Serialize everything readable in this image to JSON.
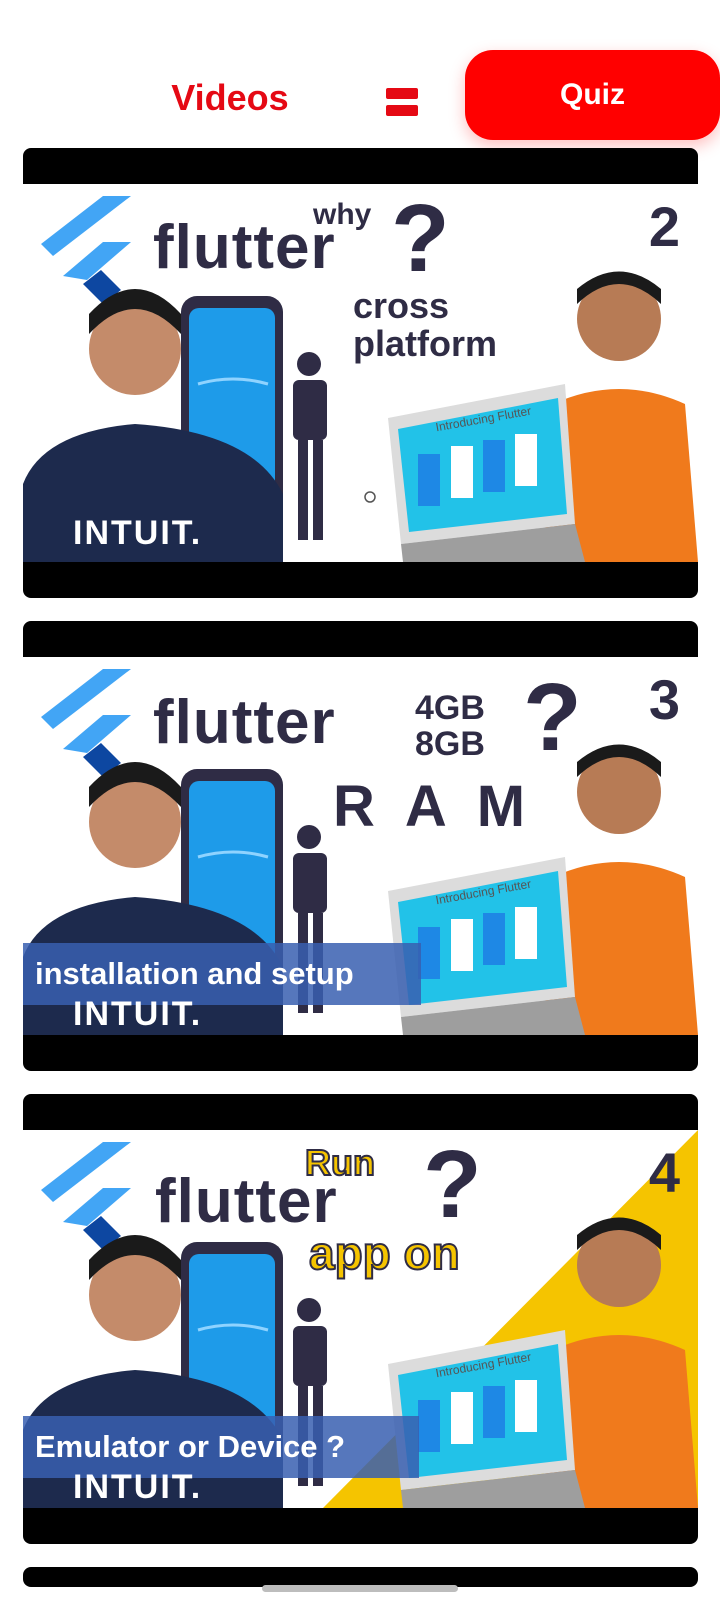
{
  "header": {
    "tab_videos": "Videos",
    "quiz_button": "Quiz",
    "accent_color": "#e50914"
  },
  "videos": [
    {
      "number": "2",
      "title_small": "why",
      "title_main": "flutter",
      "question": "?",
      "subtitle_line1": "cross",
      "subtitle_line2": "platform",
      "shirt_text": "INTUIT.",
      "laptop_caption": "Introducing Flutter"
    },
    {
      "number": "3",
      "title_main": "flutter",
      "ram_option1": "4GB",
      "ram_option2": "8GB",
      "question": "?",
      "subtitle": "R A M",
      "banner": "installation and setup",
      "shirt_text": "INTUIT.",
      "laptop_caption": "Introducing Flutter"
    },
    {
      "number": "4",
      "title_small": "Run",
      "title_main": "flutter",
      "title_after": "app on",
      "question": "?",
      "banner": "Emulator or Device ?",
      "shirt_text": "INTUIT.",
      "laptop_caption": "Introducing Flutter"
    }
  ]
}
